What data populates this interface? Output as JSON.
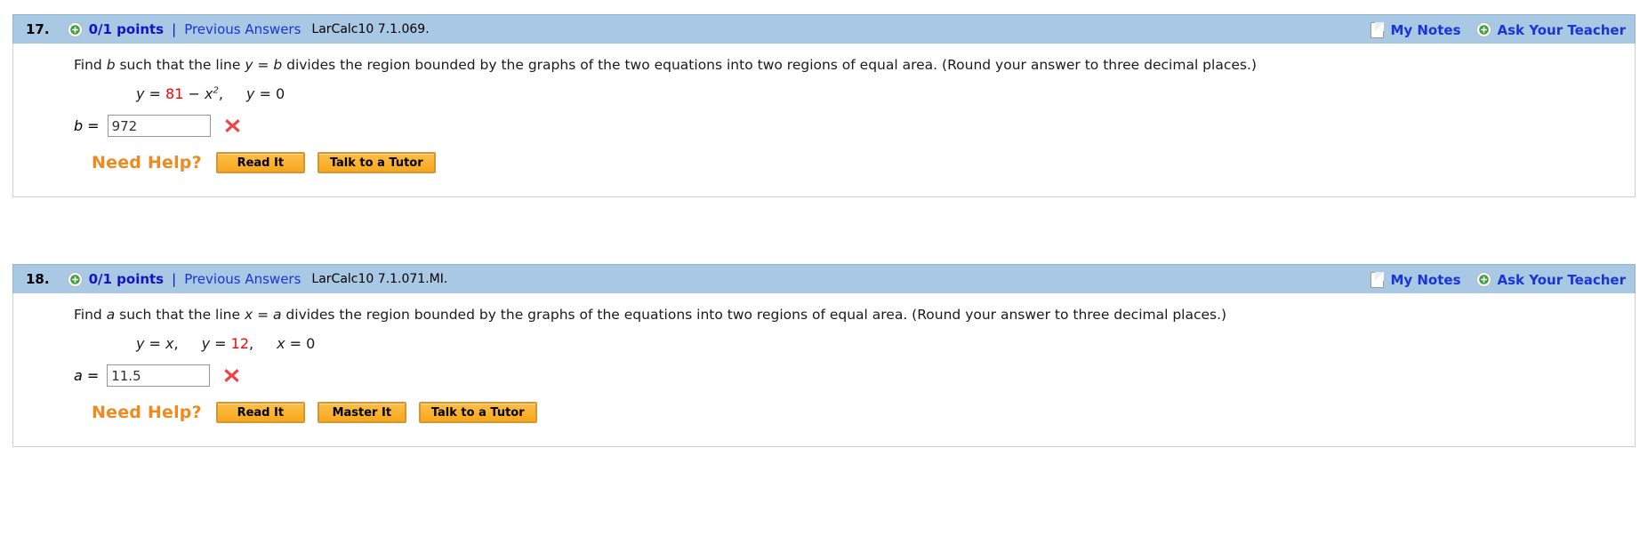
{
  "problems": [
    {
      "number": "17.",
      "points": "0/1 points",
      "separator": "|",
      "previous_answers": "Previous Answers",
      "source_id": "LarCalc10 7.1.069.",
      "my_notes": "My Notes",
      "ask_teacher": "Ask Your Teacher",
      "plus_icon": "plus-icon",
      "note_icon": "note-page-icon",
      "question": {
        "part1": "Find ",
        "var1": "b",
        "part2": " such that the line ",
        "var2": "y",
        "part3": " = ",
        "var3": "b",
        "part4": " divides the region bounded by the graphs of the two equations into two regions of equal area. (Round your answer to three decimal places.)"
      },
      "equation": {
        "lhs_var": "y",
        "eq1": " = ",
        "red_value": "81",
        "minus": " − ",
        "x_var": "x",
        "exponent": "2",
        "comma": ",",
        "rhs_var": "y",
        "eq2": " = ",
        "rhs_value": "0"
      },
      "answer": {
        "label": "b",
        "equals": "=",
        "value": "972",
        "status_icon": "red-x-incorrect-icon"
      },
      "help": {
        "label": "Need Help?",
        "buttons": [
          "Read It",
          "Talk to a Tutor"
        ]
      }
    },
    {
      "number": "18.",
      "points": "0/1 points",
      "separator": "|",
      "previous_answers": "Previous Answers",
      "source_id": "LarCalc10 7.1.071.MI.",
      "my_notes": "My Notes",
      "ask_teacher": "Ask Your Teacher",
      "plus_icon": "plus-icon",
      "note_icon": "note-page-icon",
      "question": {
        "part1": "Find ",
        "var1": "a",
        "part2": " such that the line ",
        "var2": "x",
        "part3": " = ",
        "var3": "a",
        "part4": " divides the region bounded by the graphs of the equations into two regions of equal area. (Round your answer to three decimal places.)"
      },
      "equation": {
        "lhs_var": "y",
        "eq1": " = ",
        "lhs_value": "x",
        "comma1": ",",
        "mid_var": "y",
        "eq2": " = ",
        "red_value": "12",
        "comma2": ",",
        "rhs_var": "x",
        "eq3": " = ",
        "rhs_value": "0"
      },
      "answer": {
        "label": "a",
        "equals": "=",
        "value": "11.5",
        "status_icon": "red-x-incorrect-icon"
      },
      "help": {
        "label": "Need Help?",
        "buttons": [
          "Read It",
          "Master It",
          "Talk to a Tutor"
        ]
      }
    }
  ],
  "colors": {
    "header_bar": "#a8c8e4",
    "link_blue": "#1a35d6",
    "points_blue": "#1313c4",
    "red_value": "#ff0000",
    "need_help_orange": "#f08a1e",
    "button_orange": "#f7a81b",
    "incorrect_red": "#ef4444"
  }
}
